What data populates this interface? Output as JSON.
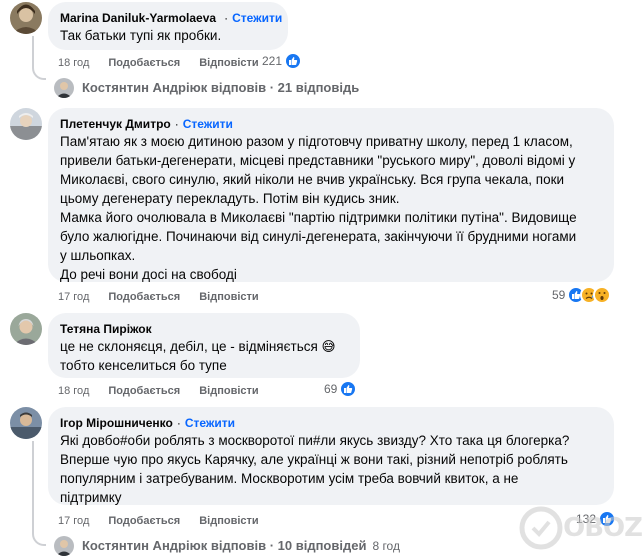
{
  "comments": [
    {
      "author": "Marina Daniluk-Yarmolaeva",
      "verified": true,
      "follow": "Стежити",
      "lines": [
        "Так батьки тупі як пробки."
      ],
      "time": "18 год",
      "like": "Подобається",
      "reply": "Відповісти",
      "reactions": "221",
      "replies": {
        "author": "Костянтин Андріюк",
        "text": "відповів · 21 відповідь"
      }
    },
    {
      "author": "Плетенчук Дмитро",
      "follow": "Стежити",
      "lines": [
        "Пам'ятаю як з моєю дитиною разом у підготовчу приватну школу, перед 1 класом,",
        "привели батьки-дегенерати, місцеві представники \"руського миру\", доволі відомі у",
        "Миколаєві, свого синулю, який ніколи не вчив українську. Вся група чекала, поки",
        "цьому дегенерату перекладуть. Потім він кудись зник.",
        "Мамка його очолювала в Миколаєві \"партію підтримки політики путіна\". Видовище",
        "було жалюгідне. Починаючи від синулі-дегенерата, закінчуючи її брудними ногами",
        "у шльопках.",
        "До речі вони досі на свободі"
      ],
      "time": "17 год",
      "like": "Подобається",
      "reply": "Відповісти",
      "reactions": "59"
    },
    {
      "author": "Тетяна Пиріжок",
      "lines": [
        "це не склоняєця, дебіл, це - відміняється 😅",
        "тобто кенселиться бо тупе"
      ],
      "time": "18 год",
      "like": "Подобається",
      "reply": "Відповісти",
      "reactions": "69"
    },
    {
      "author": "Ігор Мірошниченко",
      "follow": "Стежити",
      "lines": [
        "Які довбо#оби роблять з москворотої пи#ли якусь звизду? Хто така ця блогерка?",
        "Вперше чую про якусь Карячку, але українці ж вони такі, різний непотріб роблять",
        "популярним і затребуваним. Москворотим усім треба вовчий квиток, а не",
        "підтримку"
      ],
      "time": "17 год",
      "like": "Подобається",
      "reply": "Відповісти",
      "reactions": "132",
      "replies": {
        "author": "Костянтин Андріюк",
        "text": "відповів · 10 відповідей",
        "time": "8 год"
      }
    }
  ],
  "watermark": "OBOZ",
  "colors": {
    "follow": "#0866ff",
    "bubble": "#f0f2f5",
    "meta": "#65676b",
    "like": "#1877f2"
  }
}
